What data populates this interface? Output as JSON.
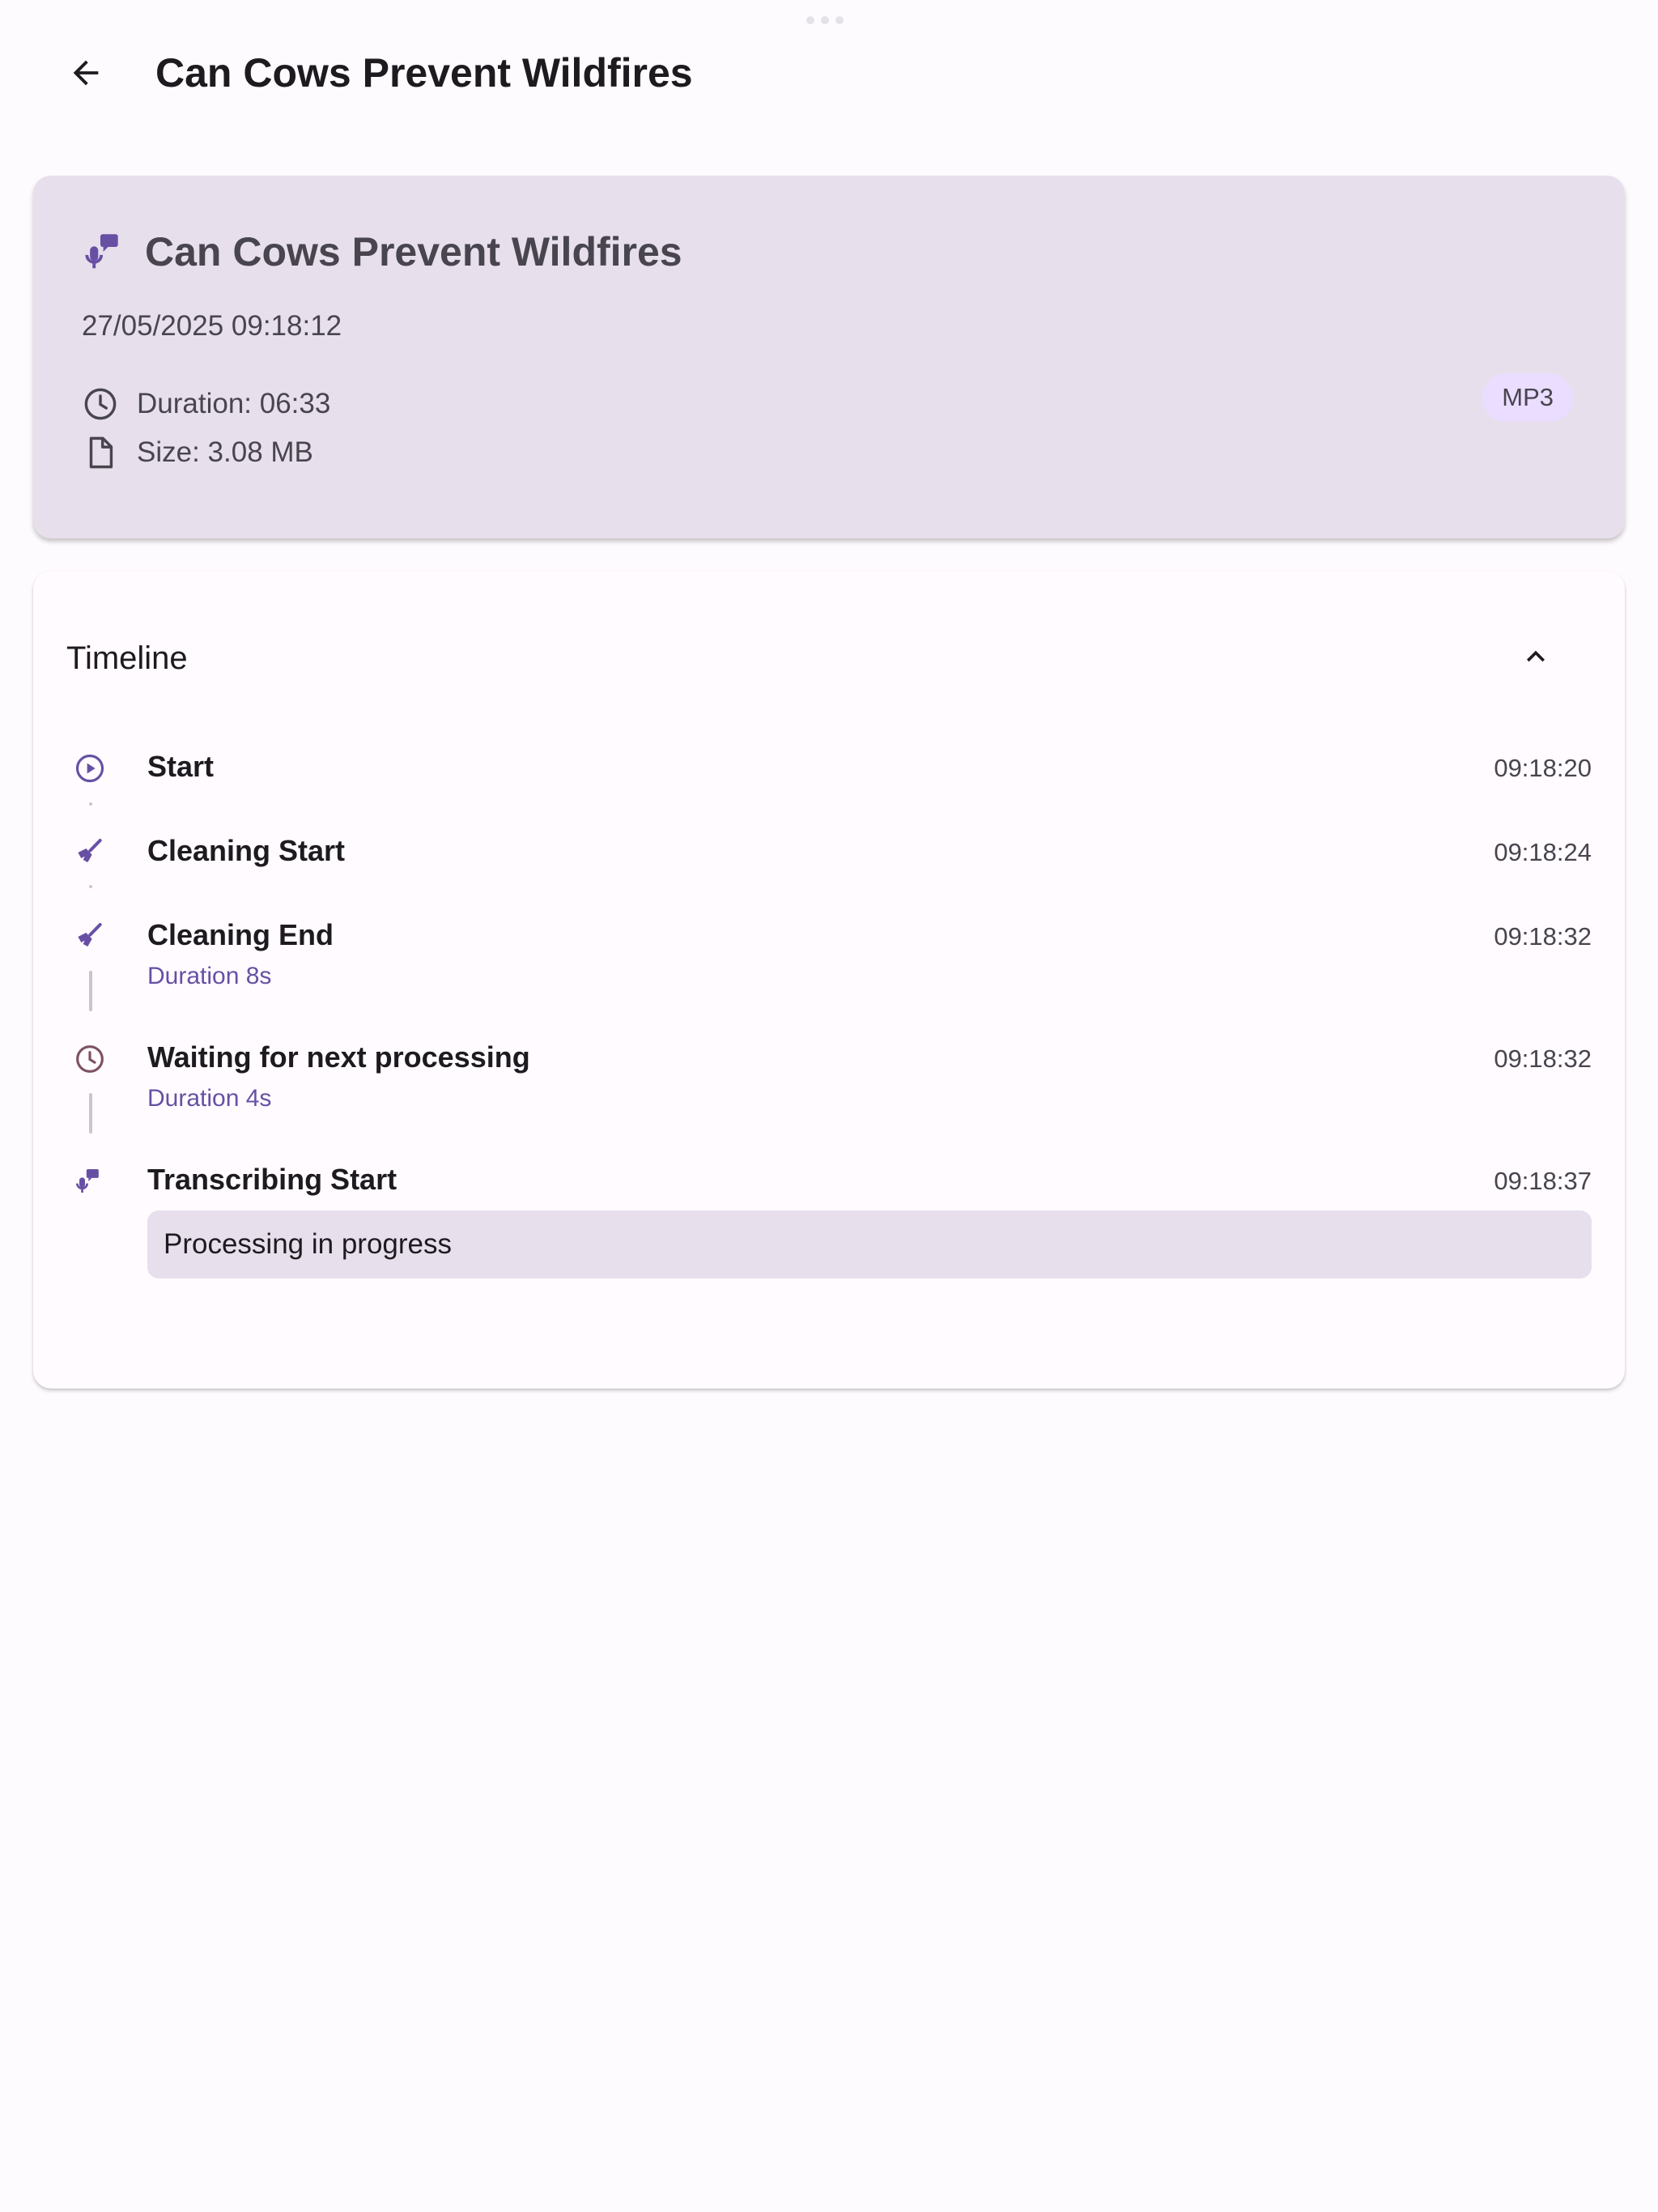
{
  "app_bar": {
    "title": "Can Cows Prevent Wildfires",
    "back_icon": "arrow-left-icon"
  },
  "info_card": {
    "title": "Can Cows Prevent Wildfires",
    "icon": "transcribe-icon",
    "datetime": "27/05/2025 09:18:12",
    "duration": "Duration: 06:33",
    "size": "Size: 3.08 MB",
    "format_badge": "MP3"
  },
  "timeline": {
    "title": "Timeline",
    "collapse_icon": "chevron-up-icon",
    "events": [
      {
        "label": "Start",
        "time": "09:18:20",
        "duration": "",
        "icon": "play-circle-icon"
      },
      {
        "label": "Cleaning Start",
        "time": "09:18:24",
        "duration": "",
        "icon": "cleaning-icon"
      },
      {
        "label": "Cleaning End",
        "time": "09:18:32",
        "duration": "Duration 8s",
        "icon": "cleaning-icon"
      },
      {
        "label": "Waiting for next processing",
        "time": "09:18:32",
        "duration": "Duration 4s",
        "icon": "clock-icon"
      },
      {
        "label": "Transcribing Start",
        "time": "09:18:37",
        "duration": "",
        "icon": "transcribe-icon",
        "status": "Processing in progress"
      }
    ]
  },
  "colors": {
    "primary": "#6750a4",
    "card_bg": "#e7e0ec",
    "surface": "#fefbfe",
    "badge_bg": "#eaddff",
    "line": "#cac4d0"
  }
}
